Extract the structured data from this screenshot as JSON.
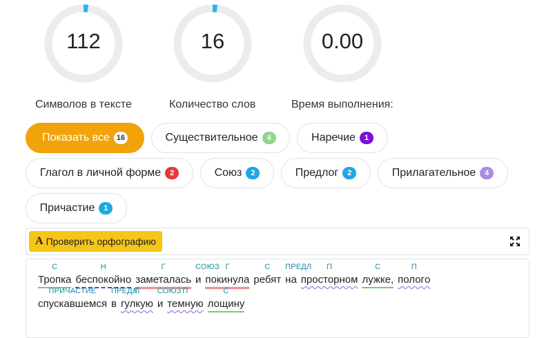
{
  "stats": [
    {
      "value": "112",
      "label": "Символов в тексте",
      "progress": 0.02
    },
    {
      "value": "16",
      "label": "Количество слов",
      "progress": 0.02
    },
    {
      "value": "0.00",
      "label": "Время выполнения:",
      "progress": 0
    }
  ],
  "colors": {
    "ring_track": "#ececec",
    "ring_fill": "#29b6e8",
    "accent": "#f0a30a",
    "check_button": "#f5c518",
    "tag_text": "#1a8aa6"
  },
  "filters": [
    {
      "label": "Показать все",
      "count": "16",
      "active": true,
      "badge_color": "#ffffff",
      "badge_text_color": "#333333"
    },
    {
      "label": "Существительное",
      "count": "4",
      "active": false,
      "badge_color": "#8ed68e",
      "badge_text_color": "#ffffff"
    },
    {
      "label": "Наречие",
      "count": "1",
      "active": false,
      "badge_color": "#7a0fd6",
      "badge_text_color": "#ffffff"
    },
    {
      "label": "Глагол в личной форме",
      "count": "2",
      "active": false,
      "badge_color": "#e53935",
      "badge_text_color": "#ffffff"
    },
    {
      "label": "Союз",
      "count": "2",
      "active": false,
      "badge_color": "#1ea7e4",
      "badge_text_color": "#ffffff"
    },
    {
      "label": "Предлог",
      "count": "2",
      "active": false,
      "badge_color": "#1ea7e4",
      "badge_text_color": "#ffffff"
    },
    {
      "label": "Прилагательное",
      "count": "4",
      "active": false,
      "badge_color": "#a98be3",
      "badge_text_color": "#ffffff"
    },
    {
      "label": "Причастие",
      "count": "1",
      "active": false,
      "badge_color": "#1ea7e4",
      "badge_text_color": "#ffffff"
    }
  ],
  "toolbar": {
    "check_icon_glyph": "A",
    "check_label": "Проверить орфографию",
    "expand_icon": "expand-icon"
  },
  "text_lines": [
    [
      {
        "word": "Тропка",
        "tag": "С",
        "type": "noun"
      },
      {
        "word": "беспокойно",
        "tag": "Н",
        "type": "adv"
      },
      {
        "word": "заметалась",
        "tag": "Г",
        "type": "verb"
      },
      {
        "word": "и",
        "tag": "СОЮЗ",
        "type": "none"
      },
      {
        "word": "покинула",
        "tag": "Г",
        "type": "verb"
      },
      {
        "word": "ребят",
        "tag": "С",
        "type": "none"
      },
      {
        "word": "на",
        "tag": "ПРЕДЛ",
        "type": "none"
      },
      {
        "word": "просторном",
        "tag": "П",
        "type": "adj"
      },
      {
        "word": "лужке,",
        "tag": "С",
        "type": "noun"
      },
      {
        "word": "пологo",
        "tag": "П",
        "type": "adj"
      }
    ],
    [
      {
        "word": "спускавшемся",
        "tag": "ПРИЧАСТИЕ",
        "type": "none"
      },
      {
        "word": "в",
        "tag": "ПРЕДЛ",
        "type": "none"
      },
      {
        "word": "гулкую",
        "tag": "П",
        "type": "adj"
      },
      {
        "word": "и",
        "tag": "СОЮЗ",
        "type": "none"
      },
      {
        "word": "темную",
        "tag": "П",
        "type": "adj"
      },
      {
        "word": "лощину",
        "tag": "С",
        "type": "noun"
      }
    ]
  ]
}
